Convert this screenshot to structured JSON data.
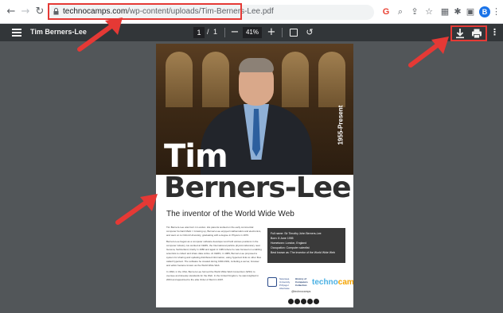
{
  "browser": {
    "url_host": "technocamps.com",
    "url_path": "/wp-content/uploads/Tim-Berners-Lee.pdf",
    "profile_initial": "B"
  },
  "pdf_toolbar": {
    "title": "Tim Berners-Lee",
    "current_page": "1",
    "page_sep": "/",
    "total_pages": "1",
    "zoom": "41%",
    "zoom_out": "−",
    "zoom_in": "+"
  },
  "document": {
    "first_name": "Tim",
    "last_name": "Berners-Lee",
    "years": "1955-Present",
    "subtitle": "The inventor of the World Wide Web",
    "paragraphs": [
      "Tim Berners-Lee was born in London. His parents worked on the early commercial computer Ferranti Mark I. Growing up, Berners-Lee enjoyed mathematics and electronics, and went on to Oxford University, graduating with a degree in Physics in 1976.",
      "Berners-Lee began as a computer software developer and held various positions in the computer industry. He worked at CERN, the International particle physics laboratory near Geneva, Switzerland, briefly in 1980 and again in 1984 where he was focused on enabling scientists to collect and share data online. At CERN, in 1989, Berners-Lee proposed a system for sharing and updating distributed information, using hypertext links to other files called hypertext. The software he created during 1990-1991, including a server, browser and editor became known as the World Wide Web.",
      "In 1994, in the USA, Berners-Lee formed the World Wide Web Consortium (W3C) to oversee and develop standards for the Web. In the United Kingdom, he was knighted in 2004 and appointed to the elite Order of Merit in 2007."
    ],
    "facts": [
      "Full name: Sir Timothy John Berners-Lee",
      "Born: 8 June 1955",
      "Hometown: London, England",
      "Occupation: Computer scientist",
      "Best known as: The inventor of the World Wide Web"
    ],
    "crest_text": "Swansea University Prifysgol Abertawe",
    "museum_text": "History of Computers Collection",
    "logo_part1": "techno",
    "logo_part2": "camps",
    "handle": "@technocamps"
  },
  "colors": {
    "annotation": "#e53935",
    "pdf_bar": "#323639",
    "viewer_bg": "#525659"
  },
  "icons": [
    "back-icon",
    "forward-icon",
    "reload-icon",
    "lock-icon",
    "google-icon",
    "zoom-icon",
    "share-icon",
    "bookmark-star-icon",
    "extensions-icon",
    "puzzle-icon",
    "sidebar-icon",
    "menu-icon",
    "fit-page-icon",
    "rotate-icon",
    "download-icon",
    "print-icon",
    "more-vert-icon"
  ]
}
